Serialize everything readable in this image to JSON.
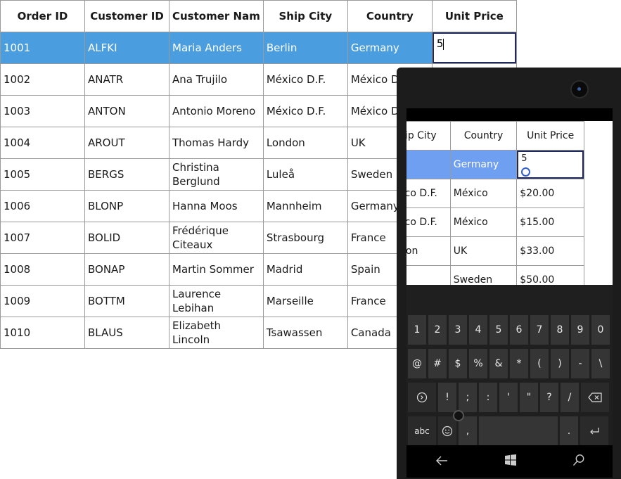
{
  "grid": {
    "columns": [
      "Order ID",
      "Customer ID",
      "Customer Nam",
      "Ship City",
      "Country",
      "Unit Price"
    ],
    "rows": [
      [
        "1001",
        "ALFKI",
        "Maria Anders",
        "Berlin",
        "Germany",
        "5"
      ],
      [
        "1002",
        "ANATR",
        "Ana Trujilo",
        "México D.F.",
        "México D.F.",
        ""
      ],
      [
        "1003",
        "ANTON",
        "Antonio Moreno",
        "México D.F.",
        "México D.F.",
        ""
      ],
      [
        "1004",
        "AROUT",
        "Thomas Hardy",
        "London",
        "UK",
        ""
      ],
      [
        "1005",
        "BERGS",
        "Christina Berglund",
        "Luleå",
        "Sweden",
        ""
      ],
      [
        "1006",
        "BLONP",
        "Hanna Moos",
        "Mannheim",
        "Germany",
        ""
      ],
      [
        "1007",
        "BOLID",
        "Frédérique Citeaux",
        "Strasbourg",
        "France",
        ""
      ],
      [
        "1008",
        "BONAP",
        "Martin Sommer",
        "Madrid",
        "Spain",
        ""
      ],
      [
        "1009",
        "BOTTM",
        "Laurence Lebihan",
        "Marseille",
        "France",
        ""
      ],
      [
        "1010",
        "BLAUS",
        "Elizabeth Lincoln",
        "Tsawassen",
        "Canada",
        ""
      ]
    ],
    "selected_accent": "#4a9ee0"
  },
  "phone": {
    "mini_grid": {
      "columns": [
        "Ship City",
        "Country",
        "Unit Price"
      ],
      "rows": [
        [
          "",
          "Germany",
          "5"
        ],
        [
          "México D.F.",
          "México",
          "$20.00"
        ],
        [
          "México D.F.",
          "México",
          "$15.00"
        ],
        [
          "London",
          "UK",
          "$33.00"
        ],
        [
          "",
          "Sweden",
          "$50.00"
        ]
      ]
    },
    "keyboard": {
      "row1": [
        "1",
        "2",
        "3",
        "4",
        "5",
        "6",
        "7",
        "8",
        "9",
        "0"
      ],
      "row2": [
        "@",
        "#",
        "$",
        "%",
        "&",
        "*",
        "(",
        ")",
        "-",
        "\\"
      ],
      "row3": [
        "!",
        ";",
        ":",
        "'",
        "\"",
        "?",
        "/"
      ],
      "abc_label": "abc",
      "comma": ",",
      "period": "."
    }
  }
}
